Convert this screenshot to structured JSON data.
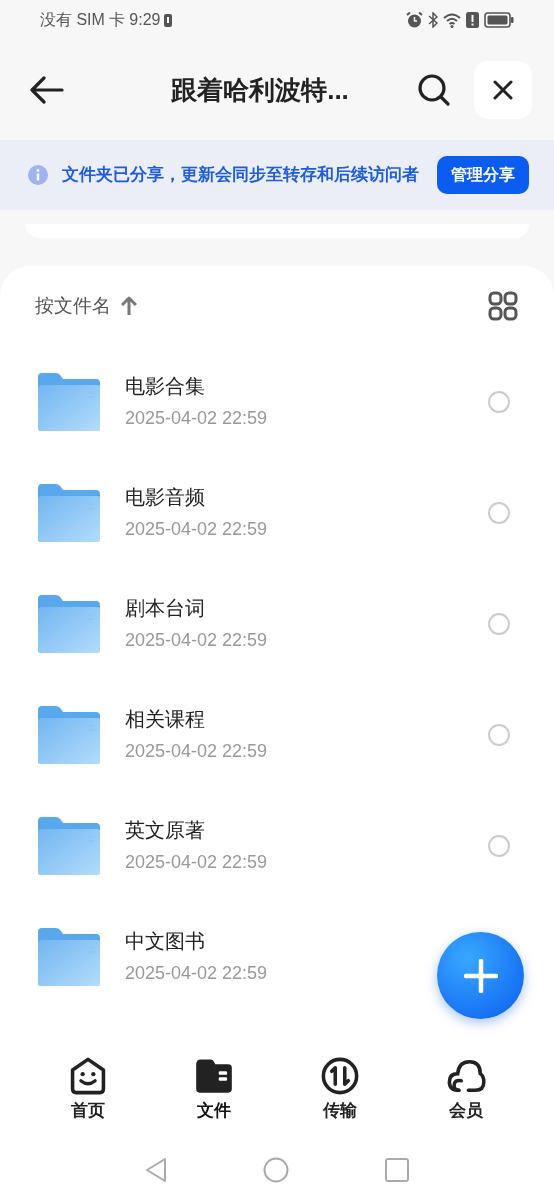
{
  "status_bar": {
    "carrier": "没有 SIM 卡",
    "time": "9:29"
  },
  "header": {
    "title": "跟着哈利波特..."
  },
  "banner": {
    "text": "文件夹已分享，更新会同步至转存和后续访问者",
    "button": "管理分享"
  },
  "sort": {
    "label": "按文件名"
  },
  "files": [
    {
      "name": "电影合集",
      "date": "2025-04-02 22:59",
      "selected": false
    },
    {
      "name": "电影音频",
      "date": "2025-04-02 22:59",
      "selected": false
    },
    {
      "name": "剧本台词",
      "date": "2025-04-02 22:59",
      "selected": false
    },
    {
      "name": "相关课程",
      "date": "2025-04-02 22:59",
      "selected": false
    },
    {
      "name": "英文原著",
      "date": "2025-04-02 22:59",
      "selected": false
    },
    {
      "name": "中文图书",
      "date": "2025-04-02 22:59"
    }
  ],
  "tabs": [
    {
      "kind": "home",
      "label": "首页",
      "selected": false
    },
    {
      "kind": "files",
      "label": "文件",
      "selected": true
    },
    {
      "kind": "transfer",
      "label": "传输",
      "selected": false
    },
    {
      "kind": "member",
      "label": "会员",
      "selected": false
    }
  ]
}
